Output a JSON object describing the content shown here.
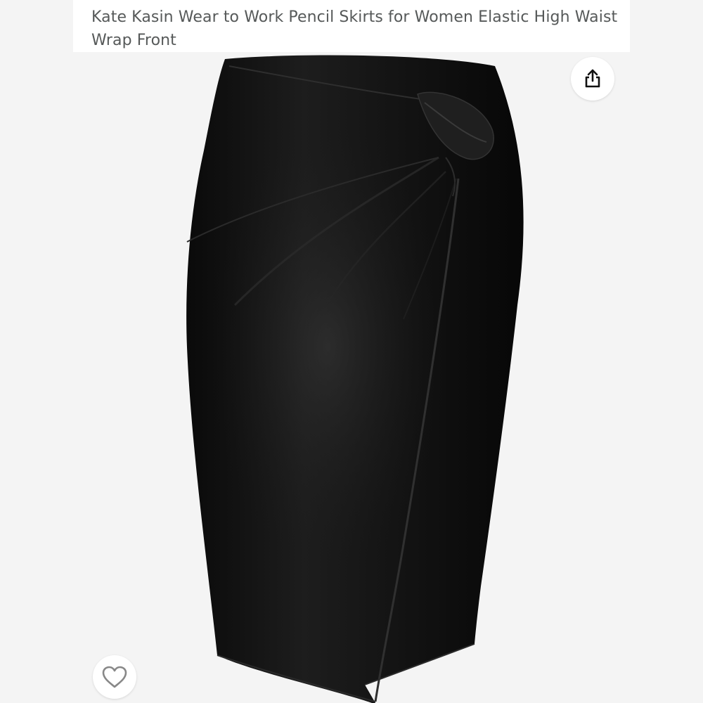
{
  "product": {
    "title": "Kate Kasin Wear to Work Pencil Skirts for Women Elastic High Waist Wrap Front",
    "image_alt": "Black faux leather pencil skirt with twisted knot wrap front"
  },
  "actions": {
    "share_icon": "share-icon",
    "favorite_icon": "heart-outline-icon"
  },
  "colors": {
    "page_bg": "#ffffff",
    "image_bg": "#f4f4f4",
    "title_text": "#565959",
    "skirt": "#121212"
  }
}
